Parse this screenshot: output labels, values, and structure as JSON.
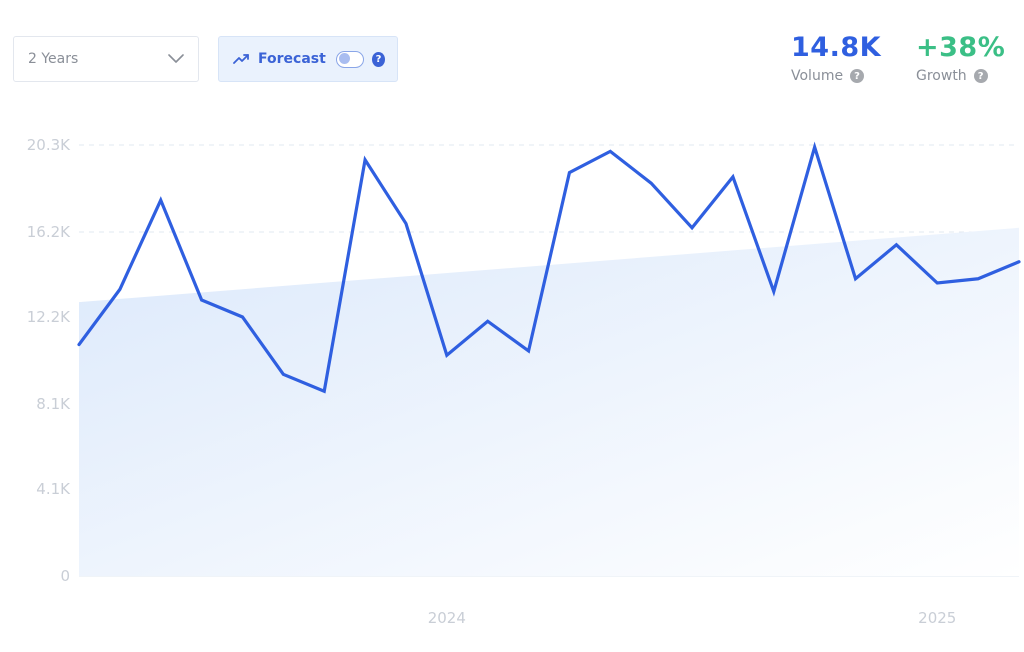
{
  "controls": {
    "range_label": "2 Years",
    "forecast_label": "Forecast",
    "forecast_on": false
  },
  "metrics": {
    "volume_value": "14.8K",
    "volume_label": "Volume",
    "growth_value": "+38%",
    "growth_label": "Growth"
  },
  "colors": {
    "line": "#2f5fe0",
    "area_top": "#dce9fb",
    "grid": "#e2e8f0",
    "growth": "#3bbf86"
  },
  "chart_data": {
    "type": "line",
    "grid": true,
    "y_ticks": [
      {
        "value": 0,
        "label": "0"
      },
      {
        "value": 4100,
        "label": "4.1K"
      },
      {
        "value": 8100,
        "label": "8.1K"
      },
      {
        "value": 12200,
        "label": "12.2K"
      },
      {
        "value": 16200,
        "label": "16.2K"
      },
      {
        "value": 20300,
        "label": "20.3K"
      }
    ],
    "ylim": [
      0,
      20300
    ],
    "x_ticks": [
      {
        "index": 9,
        "label": "2024"
      },
      {
        "index": 21,
        "label": "2025"
      }
    ],
    "series": [
      {
        "values": [
          10900,
          13500,
          17700,
          13000,
          12200,
          9500,
          8700,
          19600,
          16600,
          10400,
          12000,
          10600,
          19000,
          20000,
          18500,
          16400,
          18800,
          13400,
          20200,
          14000,
          15600,
          13800,
          14000,
          14800
        ]
      }
    ],
    "trend": {
      "start": 12900,
      "end": 16400
    }
  }
}
